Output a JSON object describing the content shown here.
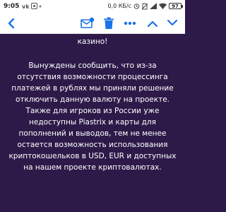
{
  "status_bar": {
    "time": "9:05",
    "network_speed": "0,0 КБ/с",
    "battery": "97",
    "icons": [
      "vk-icon",
      "notification-icon",
      "alarm-icon",
      "no-sim-icon",
      "signal-icon",
      "wifi-icon",
      "battery-icon"
    ]
  },
  "toolbar": {
    "icons": [
      "back-icon",
      "mark-unread-icon",
      "delete-icon",
      "more-icon",
      "prev-icon",
      "next-icon"
    ]
  },
  "message": {
    "paragraph_top": "казино!",
    "paragraph_main": "Вынуждены сообщить, что из-за отсутствия возможности процессинга платежей в рублях мы приняли решение отключить данную валюту на проекте. Также для игроков из России уже недоступны Piastrix и карты для пополнений и выводов, тем не менее остается возможность использования криптокошельков в USD, EUR и доступных на нашем проекте криптовалютах."
  },
  "colors": {
    "accent": "#1a73e8",
    "content_bg": "#2e1a49",
    "text": "#ffffff",
    "toolbar_bg": "#ffffff"
  }
}
